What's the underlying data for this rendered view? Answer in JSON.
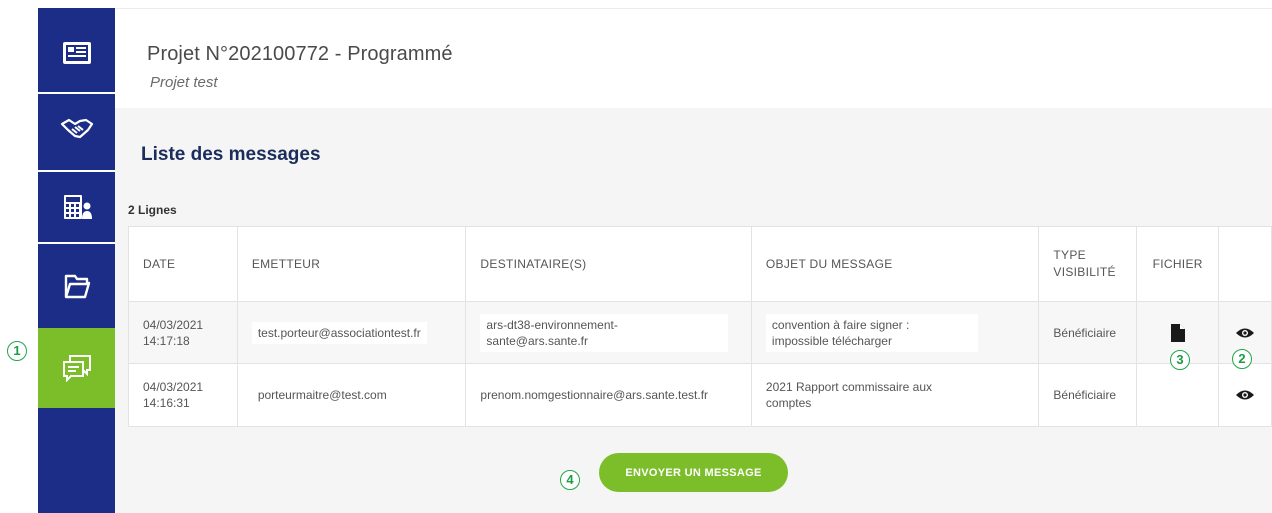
{
  "sidebar": {
    "items": [
      {
        "icon": "id-card-icon"
      },
      {
        "icon": "handshake-icon"
      },
      {
        "icon": "calculator-icon"
      },
      {
        "icon": "folder-icon"
      },
      {
        "icon": "chat-icon",
        "active": true
      }
    ],
    "accent_color": "#1b2d87",
    "active_color": "#7cbd2a"
  },
  "header": {
    "title": "Projet N°202100772 - Programmé",
    "subtitle": "Projet test"
  },
  "messages": {
    "section_title": "Liste des messages",
    "row_count": "2 Lignes",
    "columns": {
      "date": "DATE",
      "sender": "EMETTEUR",
      "recipients": "DESTINATAIRE(S)",
      "subject": "OBJET DU MESSAGE",
      "visibility_line1": "TYPE",
      "visibility_line2": "VISIBILITÉ",
      "file": "FICHIER"
    },
    "rows": [
      {
        "date": "04/03/2021",
        "time": "14:17:18",
        "sender": "test.porteur@associationtest.fr",
        "recipients_line1": "ars-dt38-environnement-",
        "recipients_line2": "sante@ars.sante.fr",
        "subject_line1": "convention à faire signer :",
        "subject_line2": "impossible télécharger",
        "visibility": "Bénéficiaire",
        "has_file": true
      },
      {
        "date": "04/03/2021",
        "time": "14:16:31",
        "sender": "porteurmaitre@test.com",
        "recipients_line1": "prenom.nomgestionnaire@ars.sante.test.fr",
        "recipients_line2": "",
        "subject_line1": "2021 Rapport commissaire aux",
        "subject_line2": "comptes",
        "visibility": "Bénéficiaire",
        "has_file": false
      }
    ],
    "send_button": "ENVOYER UN MESSAGE"
  },
  "markers": [
    "1",
    "2",
    "3",
    "4"
  ]
}
